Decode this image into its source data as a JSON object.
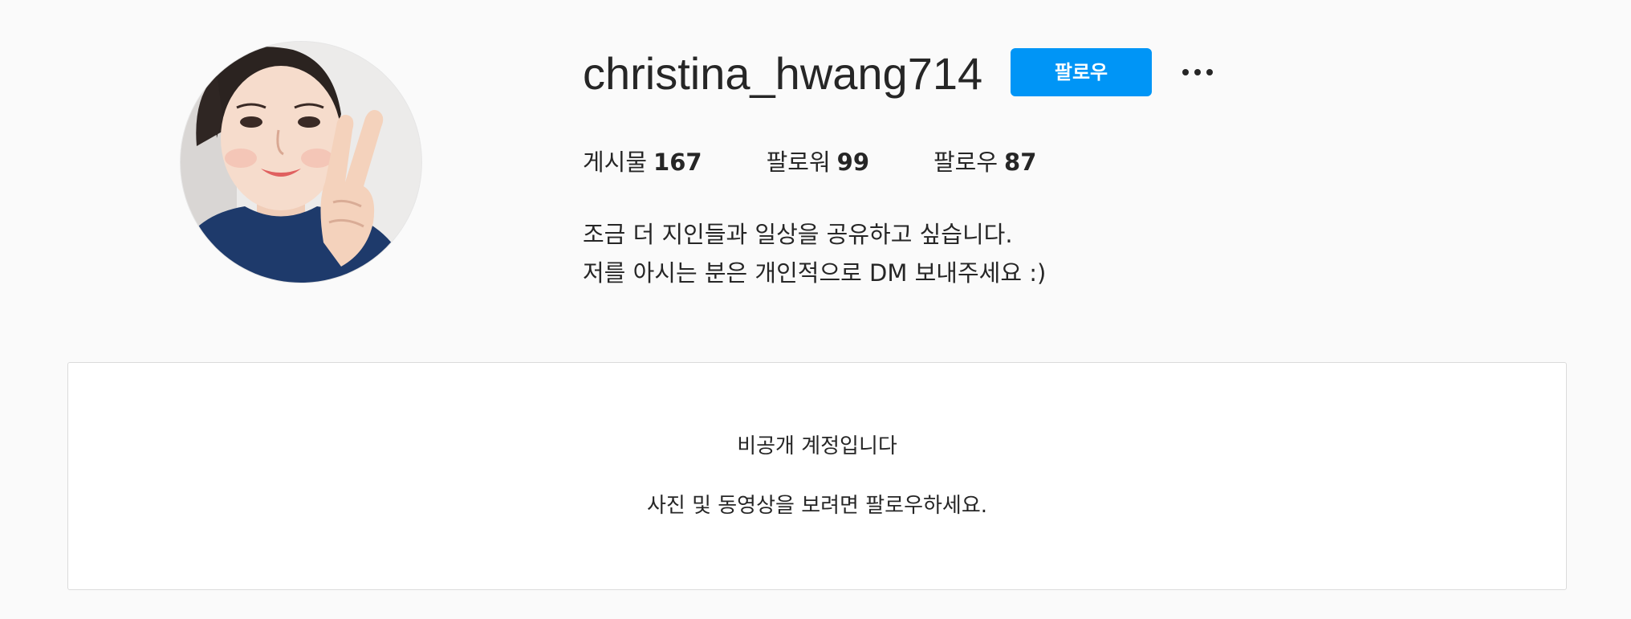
{
  "profile": {
    "username": "christina_hwang714",
    "follow_label": "팔로우",
    "more_icon": "more-horizontal-icon",
    "avatar_alt": "profile photo"
  },
  "stats": [
    {
      "label": "게시물",
      "value": "167"
    },
    {
      "label": "팔로워",
      "value": "99"
    },
    {
      "label": "팔로우",
      "value": "87"
    }
  ],
  "bio": {
    "line1": "조금 더 지인들과 일상을 공유하고 싶습니다.",
    "line2": "저를 아시는 분은 개인적으로 DM 보내주세요 :)"
  },
  "private": {
    "title": "비공개 계정입니다",
    "subtitle": "사진 및 동영상을 보려면 팔로우하세요."
  },
  "colors": {
    "accent": "#0095f6",
    "background": "#fafafa",
    "text": "#262626",
    "border": "#dbdbdb"
  }
}
